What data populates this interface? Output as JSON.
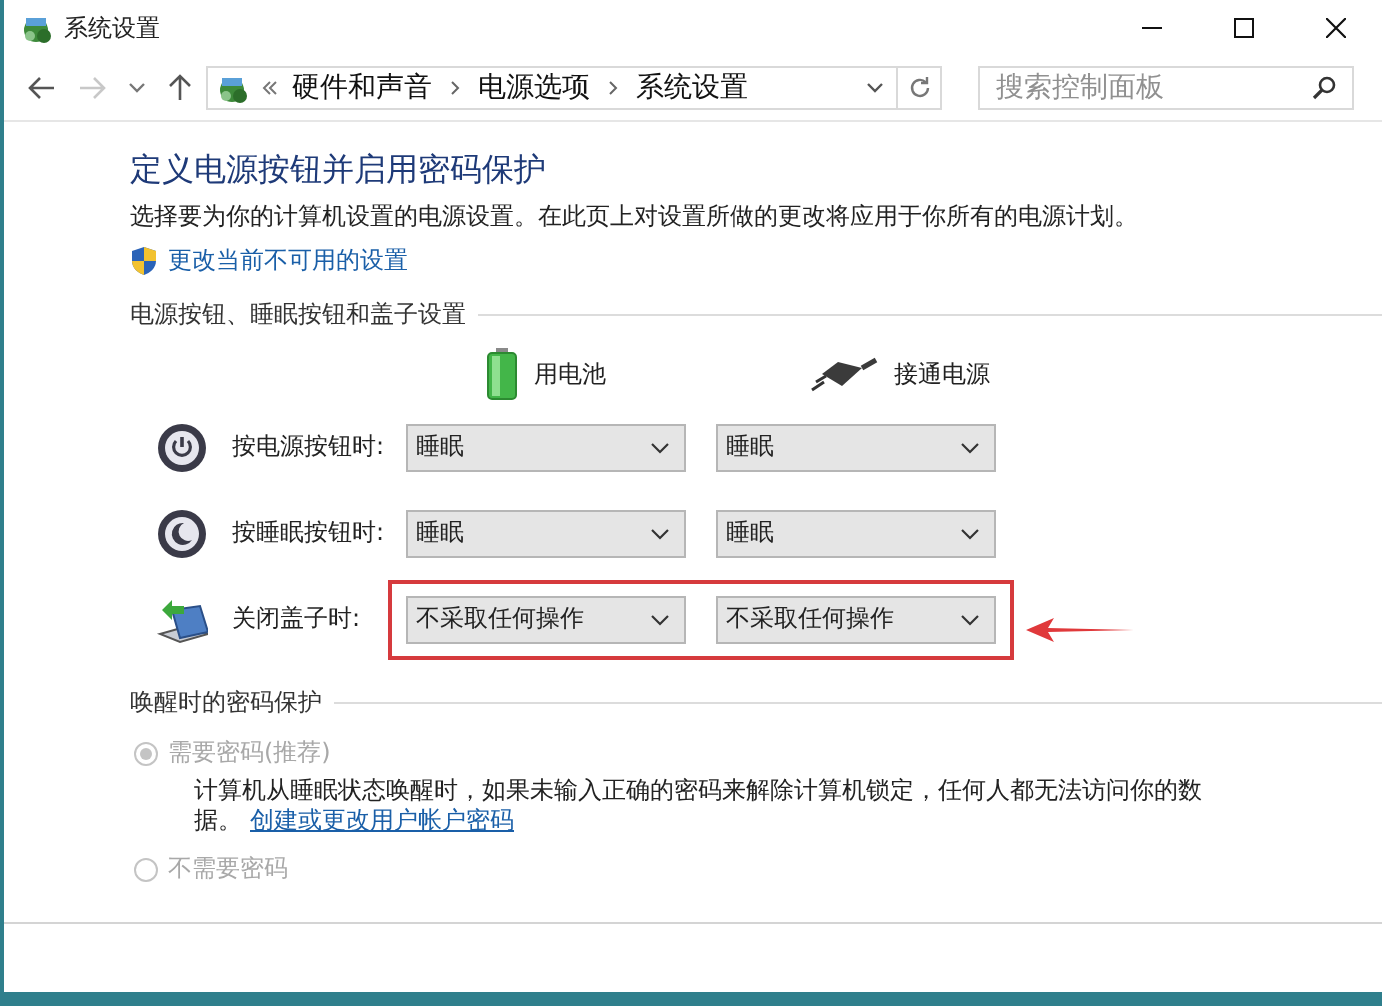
{
  "window": {
    "title": "系统设置"
  },
  "nav": {
    "forward_disabled": true,
    "breadcrumb": [
      "硬件和声音",
      "电源选项",
      "系统设置"
    ],
    "search": {
      "placeholder": "搜索控制面板"
    }
  },
  "content": {
    "heading": "定义电源按钮并启用密码保护",
    "description": "选择要为你的计算机设置的电源设置。在此页上对设置所做的更改将应用于你所有的电源计划。",
    "admin_link": "更改当前不可用的设置",
    "button_section": {
      "title": "电源按钮、睡眠按钮和盖子设置",
      "columns": [
        {
          "label": "用电池",
          "kind": "battery"
        },
        {
          "label": "接通电源",
          "kind": "plug"
        }
      ],
      "rows": [
        {
          "label": "按电源按钮时:",
          "kind": "power",
          "values": [
            "睡眠",
            "睡眠"
          ],
          "highlighted": false
        },
        {
          "label": "按睡眠按钮时:",
          "kind": "sleep",
          "values": [
            "睡眠",
            "睡眠"
          ],
          "highlighted": false
        },
        {
          "label": "关闭盖子时:",
          "kind": "lid",
          "values": [
            "不采取任何操作",
            "不采取任何操作"
          ],
          "highlighted": true
        }
      ]
    },
    "password_section": {
      "title": "唤醒时的密码保护",
      "options": [
        {
          "label": "需要密码(推荐)",
          "selected": true,
          "disabled": true,
          "description": "计算机从睡眠状态唤醒时，如果未输入正确的密码来解除计算机锁定，任何人都无法访问你的数",
          "description_end": "据。",
          "link": "创建或更改用户帐户密码"
        },
        {
          "label": "不需要密码",
          "selected": false,
          "disabled": true
        }
      ]
    }
  }
}
